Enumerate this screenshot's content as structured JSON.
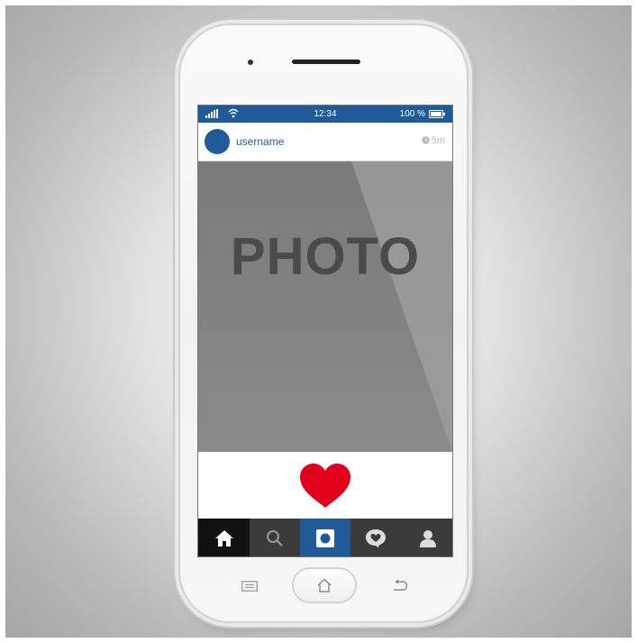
{
  "status_bar": {
    "time": "12:34",
    "battery_percent": "100 %",
    "signal_icon": "signal-bars-icon",
    "wifi_icon": "wifi-icon",
    "battery_icon": "battery-icon"
  },
  "post": {
    "username": "username",
    "time": "5m",
    "photo_label": "PHOTO",
    "like_icon": "heart-icon"
  },
  "tab_bar": {
    "tabs": [
      {
        "icon": "home-icon",
        "active": true
      },
      {
        "icon": "search-icon",
        "active": false
      },
      {
        "icon": "camera-icon",
        "active": false
      },
      {
        "icon": "activity-heart-icon",
        "active": false
      },
      {
        "icon": "profile-icon",
        "active": false
      }
    ]
  },
  "hardware_buttons": [
    "menu-icon",
    "home-outline-icon",
    "back-icon"
  ],
  "colors": {
    "accent": "#1e5b98",
    "like": "#e0001b",
    "photo_bg": "#8a8a8a",
    "tab_bar": "#3b3b3b"
  }
}
